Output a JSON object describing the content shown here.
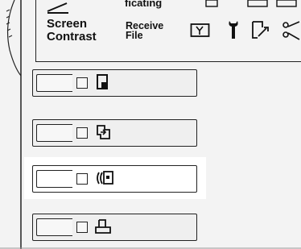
{
  "header": {
    "cut_label": "ficating",
    "screen_contrast": [
      "Screen",
      "Contrast"
    ],
    "receive_file": [
      "Receive",
      "File"
    ]
  },
  "top_icons": [
    "mailbox-icon",
    "wrench-icon",
    "document-arrow-icon",
    "scissors-icon"
  ],
  "mode_rows": [
    {
      "name": "one-sided-original",
      "icon": "single-page-icon"
    },
    {
      "name": "two-sided-original",
      "icon": "duplex-page-icon"
    },
    {
      "name": "book-original",
      "icon": "book-page-icon"
    },
    {
      "name": "booklet-original",
      "icon": "stacked-page-icon"
    }
  ],
  "highlighted_row": 2
}
